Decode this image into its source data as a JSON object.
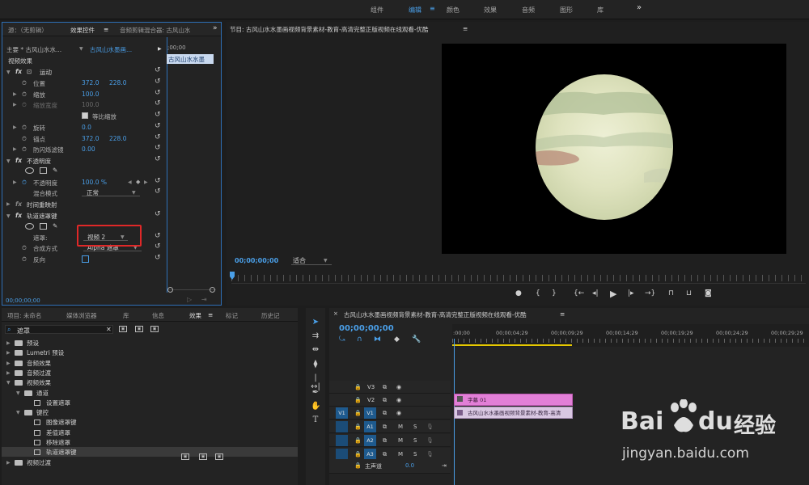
{
  "workspace_tabs": [
    "组件",
    "编辑",
    "颜色",
    "效果",
    "音频",
    "图形",
    "库"
  ],
  "workspace_more": "»",
  "effect_controls": {
    "tabs": [
      "源：（无剪辑）",
      "效果控件",
      "音频剪辑混合器: 古风山水"
    ],
    "more": "»",
    "master_label": "主要 * 古风山水水...",
    "clip_label": "古风山水墨画...",
    "mini_clip": "古风山水水墨",
    "mini_time": ";00;00",
    "section_video": "视频效果",
    "motion": "运动",
    "position_label": "位置",
    "position_x": "372.0",
    "position_y": "228.0",
    "scale_label": "缩放",
    "scale_val": "100.0",
    "scale_w_label": "缩放宽度",
    "scale_w_val": "100.0",
    "uniform_label": "等比缩放",
    "rotation_label": "旋转",
    "rotation_val": "0.0",
    "anchor_label": "锚点",
    "anchor_x": "372.0",
    "anchor_y": "228.0",
    "flicker_label": "防闪烁滤镜",
    "flicker_val": "0.00",
    "opacity_section": "不透明度",
    "opacity_label": "不透明度",
    "opacity_val": "100.0 %",
    "blend_label": "混合模式",
    "blend_val": "正常",
    "time_remap": "时间重映射",
    "track_matte": "轨道遮罩键",
    "matte_label": "遮罩:",
    "matte_val": "视频 2",
    "composite_label": "合成方式",
    "composite_val": "Alpha 遮罩",
    "reverse_label": "反向",
    "timecode": "00;00;00;00",
    "fx": "fx"
  },
  "program_monitor": {
    "title": "节目: 古风山水水墨画视频背景素材-教育-高清完整正版视频在线观看-优酷",
    "timecode": "00;00;00;00",
    "fit": "适合"
  },
  "effects_panel": {
    "tabs": [
      "项目: 未命名",
      "媒体浏览器",
      "库",
      "信息",
      "效果",
      "标记",
      "历史记"
    ],
    "search_value": "遮罩",
    "tree": [
      {
        "label": "预设",
        "indent": 0,
        "kind": "folder",
        "expanded": false
      },
      {
        "label": "Lumetri 预设",
        "indent": 0,
        "kind": "folder",
        "expanded": false
      },
      {
        "label": "音频效果",
        "indent": 0,
        "kind": "folder",
        "expanded": false
      },
      {
        "label": "音频过渡",
        "indent": 0,
        "kind": "folder",
        "expanded": false
      },
      {
        "label": "视频效果",
        "indent": 0,
        "kind": "folder",
        "expanded": true
      },
      {
        "label": "通道",
        "indent": 1,
        "kind": "folder",
        "expanded": true
      },
      {
        "label": "设置遮罩",
        "indent": 2,
        "kind": "item",
        "expanded": false
      },
      {
        "label": "键控",
        "indent": 1,
        "kind": "folder",
        "expanded": true
      },
      {
        "label": "图像遮罩键",
        "indent": 2,
        "kind": "item",
        "expanded": false
      },
      {
        "label": "差值遮罩",
        "indent": 2,
        "kind": "item",
        "expanded": false
      },
      {
        "label": "移除遮罩",
        "indent": 2,
        "kind": "item",
        "expanded": false
      },
      {
        "label": "轨道遮罩键",
        "indent": 2,
        "kind": "item",
        "expanded": false
      },
      {
        "label": "视频过渡",
        "indent": 0,
        "kind": "folder",
        "expanded": false
      }
    ]
  },
  "timeline": {
    "title": "古风山水水墨画视频背景素材-教育-高清完整正版视频在线观看-优酷",
    "timecode": "00;00;00;00",
    "ruler": [
      ":00;00",
      "00;00;04;29",
      "00;00;09;29",
      "00;00;14;29",
      "00;00;19;29",
      "00;00;24;29",
      "00;00;29;29"
    ],
    "tracks": [
      "V3",
      "V2",
      "V1",
      "A1",
      "A2",
      "A3"
    ],
    "target_v": "V1",
    "master": "主声道",
    "master_val": "0.0",
    "clip_v2": "字幕 01",
    "clip_v1": "古风山水水墨画视频背景素材-教育-高清",
    "m": "M",
    "s": "S"
  },
  "watermark": {
    "brand": "Bai",
    "brand2": "du",
    "jingyan": "经验",
    "url": "jingyan.baidu.com"
  }
}
